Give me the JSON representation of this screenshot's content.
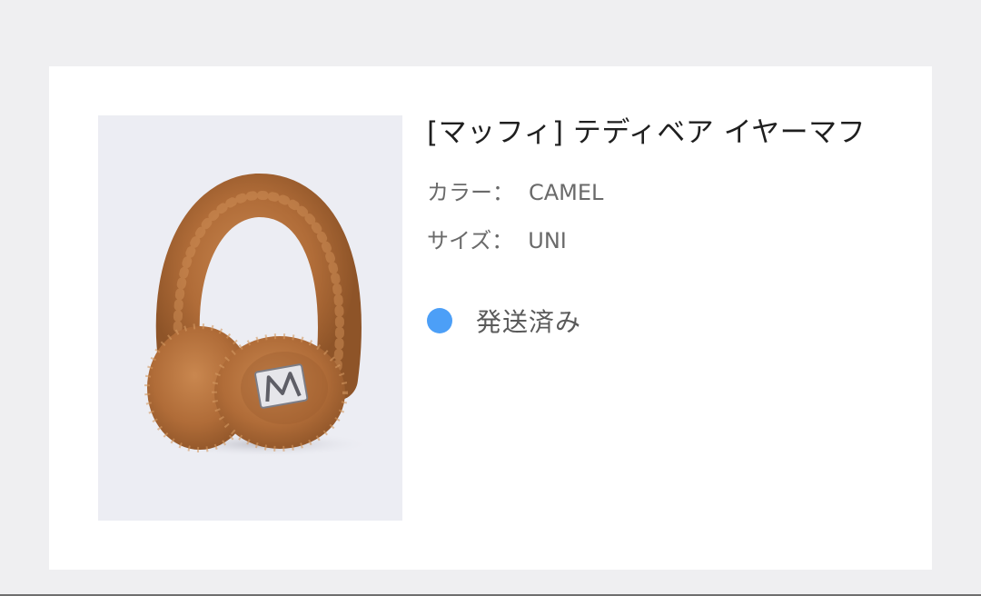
{
  "order_item": {
    "title": "[マッフィ] テディベア イヤーマフ",
    "color_label": "カラー：",
    "color_value": "CAMEL",
    "size_label": "サイズ：",
    "size_value": "UNI",
    "status_text": "発送済み",
    "status_color": "#4c9ff7",
    "image_icon": "teddy-earmuff-photo"
  },
  "colors": {
    "page_bg": "#efeff1",
    "card_bg": "#ffffff",
    "image_bg": "#ecedf3",
    "title_text": "#1f1f1f",
    "attr_text": "#6a6a6a",
    "product_fur": "#b5703b"
  }
}
